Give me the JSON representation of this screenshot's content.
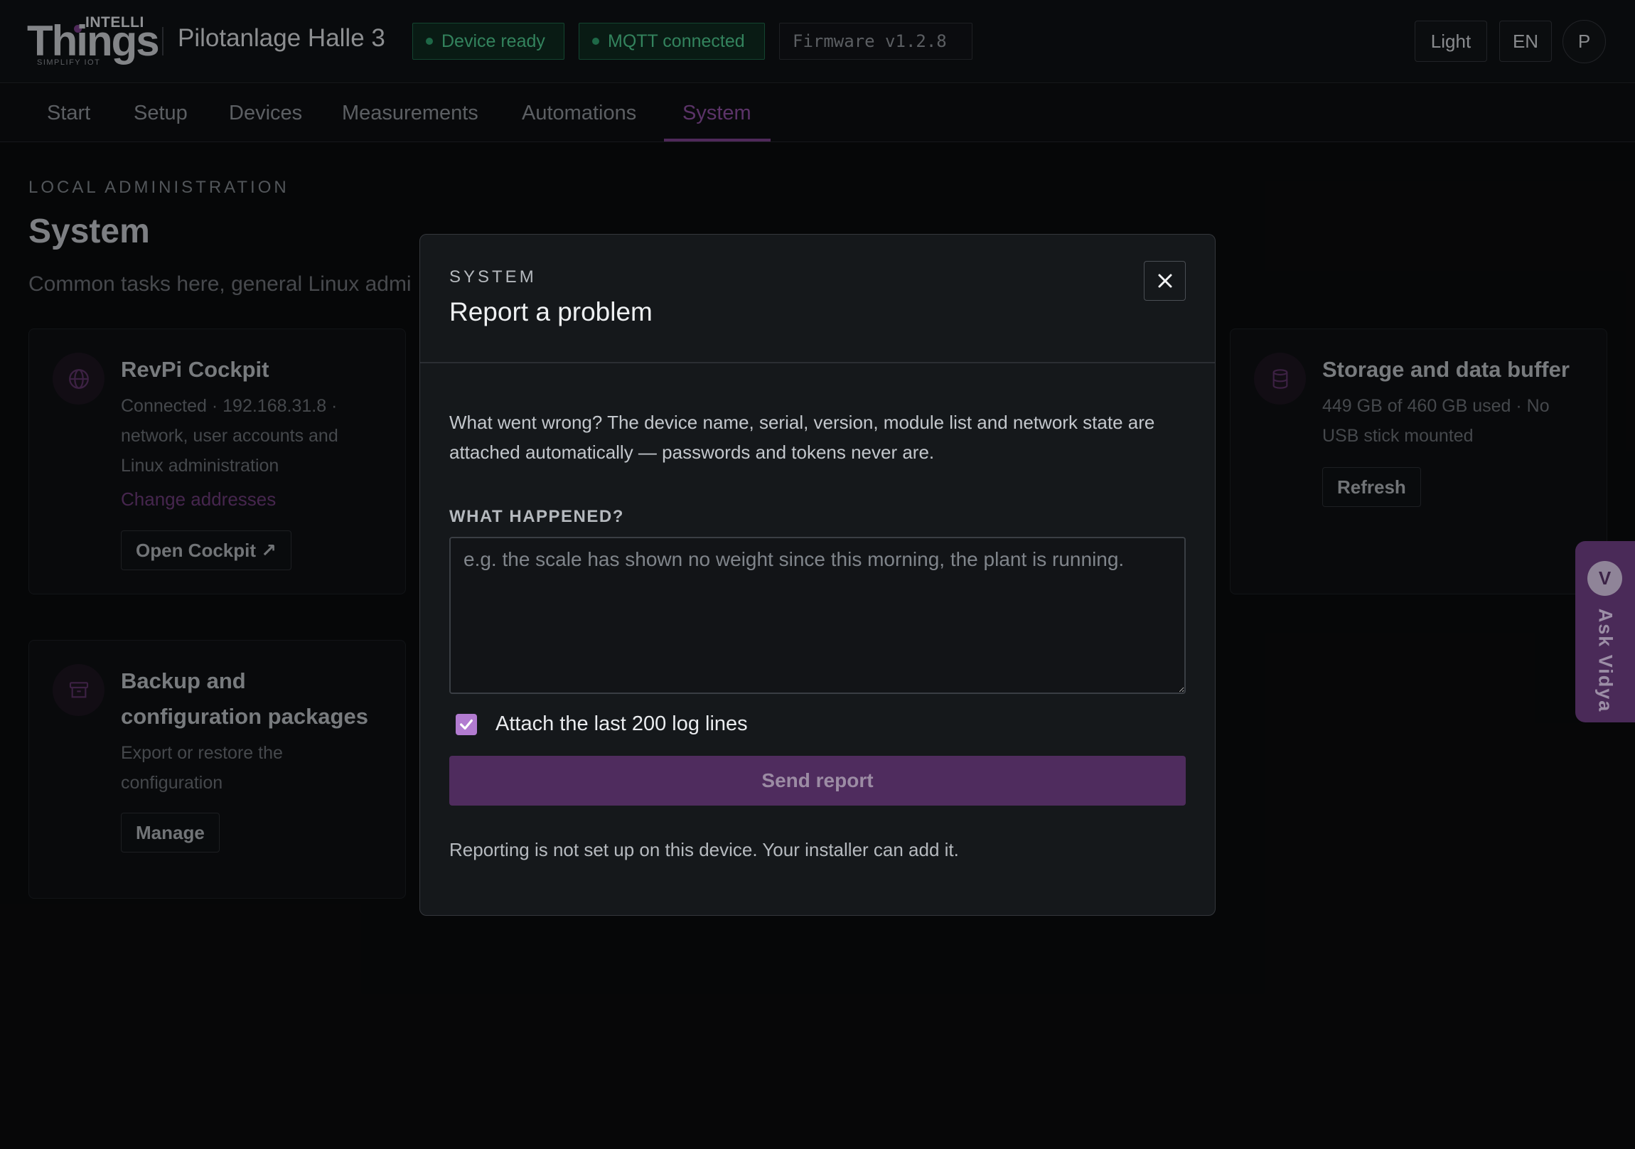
{
  "header": {
    "logo": {
      "top": "INTELLI",
      "main": "Things",
      "tagline": "SIMPLIFY IOT"
    },
    "site_name": "Pilotanlage Halle 3",
    "status": {
      "device": "Device ready",
      "mqtt": "MQTT connected",
      "firmware": "Firmware v1.2.8"
    },
    "theme_button": "Light",
    "language_button": "EN",
    "user_initial": "P"
  },
  "nav": {
    "tabs": [
      {
        "label": "Start"
      },
      {
        "label": "Setup"
      },
      {
        "label": "Devices"
      },
      {
        "label": "Measurements"
      },
      {
        "label": "Automations"
      },
      {
        "label": "System",
        "active": true
      }
    ]
  },
  "page": {
    "eyebrow": "LOCAL ADMINISTRATION",
    "title": "System",
    "subtitle": "Common tasks here, general Linux admi"
  },
  "cards": {
    "cockpit": {
      "title": "RevPi Cockpit",
      "lines": [
        "Connected · 192.168.31.8 ·",
        "network, user accounts and",
        "Linux administration"
      ],
      "link": "Change addresses",
      "button": "Open Cockpit ↗"
    },
    "backup": {
      "title_lines": [
        "Backup and",
        "configuration packages"
      ],
      "lines": [
        "Export or restore the",
        "configuration"
      ],
      "button": "Manage"
    },
    "storage": {
      "title": "Storage and data buffer",
      "lines": [
        "449 GB of 460 GB used · No",
        "USB stick mounted"
      ],
      "button": "Refresh"
    }
  },
  "modal": {
    "eyebrow": "SYSTEM",
    "title": "Report a problem",
    "description": "What went wrong? The device name, serial, version, module list and network state are attached automatically — passwords and tokens never are.",
    "field_label": "WHAT HAPPENED?",
    "field_value": "",
    "field_placeholder": "e.g. the scale has shown no weight since this morning, the plant is running.",
    "attach_logs_label": "Attach the last 200 log lines",
    "attach_logs_checked": true,
    "send_button": "Send report",
    "note": "Reporting is not set up on this device. Your installer can add it."
  },
  "assistant": {
    "badge": "V",
    "label": "Ask Vidya"
  },
  "colors": {
    "accent": "#7a3f8a",
    "status_green": "#4fc98f",
    "send_button": "#4f2c5e",
    "checkbox": "#b27bd0"
  }
}
